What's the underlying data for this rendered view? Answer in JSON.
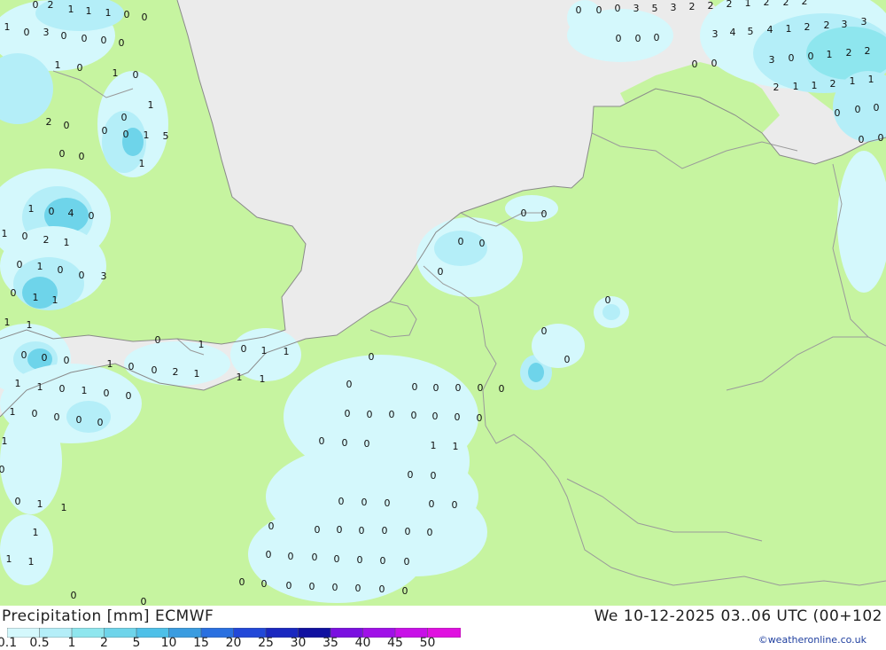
{
  "header": {
    "title": "Precipitation [mm] ECMWF",
    "datetime": "We 10-12-2025 03..06 UTC (00+102",
    "credit": "©weatheronline.co.uk"
  },
  "legend": {
    "labels": [
      "0.1",
      "0.5",
      "1",
      "2",
      "5",
      "10",
      "15",
      "20",
      "25",
      "30",
      "35",
      "40",
      "45",
      "50"
    ],
    "colors": [
      "#d4f8fc",
      "#b4eef8",
      "#8ee6ee",
      "#6ed4ea",
      "#4ec0e8",
      "#3a9ce0",
      "#2a70e0",
      "#2248d8",
      "#1a28c0",
      "#1010a0",
      "#7a10e0",
      "#a010e8",
      "#c810e8",
      "#e010e0",
      "#c810c0"
    ]
  },
  "colors": {
    "sea": "#ebebeb",
    "land": "#c6f4a0",
    "precip_light": "#d4f8fc",
    "precip_mid": "#b4eef8",
    "precip_heavy": "#8ee6ee",
    "precip_strong": "#6ed4ea",
    "border": "#9a9a9a"
  },
  "map_values": [
    "0",
    "2",
    "1",
    "1",
    "1",
    "0",
    "0",
    "1",
    "0",
    "3",
    "0",
    "0",
    "0",
    "0",
    "1",
    "0",
    "1",
    "0",
    "1",
    "0",
    "2",
    "0",
    "0",
    "0",
    "1",
    "5",
    "0",
    "0",
    "1",
    "1",
    "0",
    "4",
    "0",
    "1",
    "0",
    "2",
    "1",
    "0",
    "1",
    "0",
    "0",
    "3",
    "0",
    "1",
    "1",
    "1",
    "1",
    "0",
    "1",
    "0",
    "0",
    "0",
    "1",
    "0",
    "0",
    "2",
    "1",
    "1",
    "1",
    "0",
    "1",
    "0",
    "0",
    "1",
    "0",
    "0",
    "0",
    "0",
    "0",
    "1",
    "1",
    "1",
    "1",
    "1",
    "0",
    "0",
    "1",
    "1",
    "1",
    "1",
    "1",
    "0",
    "0",
    "0",
    "0",
    "0",
    "0",
    "0",
    "0",
    "0",
    "0",
    "0",
    "0",
    "0",
    "0",
    "0",
    "0",
    "0",
    "0",
    "0",
    "0",
    "0",
    "0",
    "0",
    "0",
    "0",
    "0",
    "0",
    "0",
    "0",
    "0",
    "0",
    "0",
    "0",
    "0",
    "1",
    "1",
    "0",
    "0",
    "0",
    "0",
    "0",
    "0",
    "0",
    "0",
    "0",
    "0",
    "0",
    "0",
    "0",
    "0",
    "0",
    "0",
    "0",
    "0",
    "0",
    "0",
    "0",
    "0",
    "0",
    "0",
    "0",
    "3",
    "5",
    "3",
    "2",
    "2",
    "2",
    "1",
    "2",
    "2",
    "2",
    "3",
    "4",
    "5",
    "4",
    "1",
    "2",
    "2",
    "3",
    "3",
    "3",
    "0",
    "0",
    "1",
    "2",
    "2",
    "2",
    "1",
    "1",
    "2",
    "1",
    "1",
    "0",
    "0",
    "0",
    "0",
    "0",
    "0",
    "0",
    "0",
    "0",
    "0"
  ]
}
